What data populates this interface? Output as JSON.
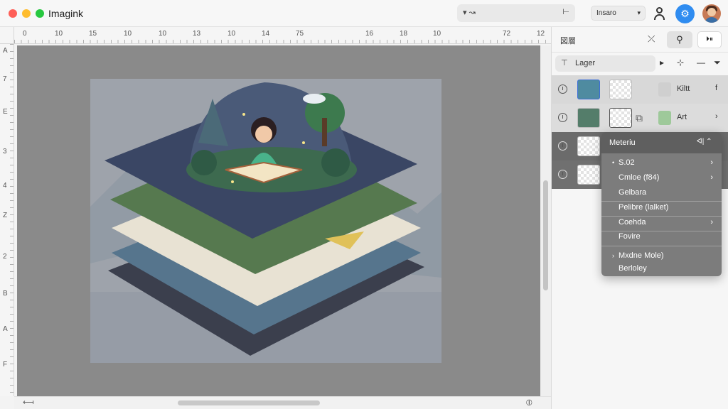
{
  "app": {
    "title": "Imagink"
  },
  "titlebar": {
    "search_icon": "brush-icon",
    "search_lead": "▾ ↝",
    "search_trail": "⊢",
    "mode_label": "Insaro",
    "mode_chevron": "▾",
    "user_icon": "user-icon",
    "gear_icon": "gear-icon",
    "avatar_icon": "avatar"
  },
  "ruler": {
    "top_ticks": [
      "0",
      "10",
      "15",
      "10",
      "10",
      "13",
      "10",
      "14",
      "75",
      "16",
      "18",
      "10",
      "72",
      "12"
    ],
    "left_ticks": [
      "A",
      "7",
      "E",
      "3",
      "4",
      "Z",
      "2",
      "B",
      "A",
      "F"
    ]
  },
  "canvas": {
    "zoom_icon": "scroll-left-icon",
    "h_lead": "⟻",
    "h_trail": "⦶"
  },
  "panel": {
    "title": "図層",
    "pin": "⤫",
    "seg_icon": "⚲",
    "seg2_icon": "⏵⏸",
    "search_icon": "⊤",
    "search_label": "Lager",
    "tools": [
      "▸",
      "⊹",
      "—",
      "⏷"
    ],
    "layers": [
      {
        "name": "Kiltt",
        "more": "f"
      },
      {
        "name": "Art",
        "more": "›"
      },
      {
        "name": "",
        "more": ""
      },
      {
        "name": "",
        "more": ""
      }
    ]
  },
  "menu": {
    "title": "Meteriu",
    "controls": "ᐊ|  ⌃",
    "items": [
      {
        "label": "S.02",
        "chevron": "›",
        "dot": "•"
      },
      {
        "label": "Cmloe (f84)",
        "chevron": "›",
        "dot": ""
      },
      {
        "label": "Gelbara",
        "chevron": "",
        "dot": ""
      },
      {
        "label": "Pelibre (lalket)",
        "chevron": "",
        "dot": ""
      },
      {
        "label": "Coehda",
        "chevron": "›",
        "dot": ""
      },
      {
        "label": "Fovire",
        "chevron": "",
        "dot": ""
      },
      {
        "label": "Mxdne Mole)",
        "chevron": "",
        "dot": "›"
      },
      {
        "label": "Berloley",
        "chevron": "",
        "dot": ""
      }
    ]
  },
  "colors": {
    "accent": "#2f8cf0",
    "canvas_bg": "#8a8a8a",
    "menu_bg": "#7c7c7c"
  }
}
